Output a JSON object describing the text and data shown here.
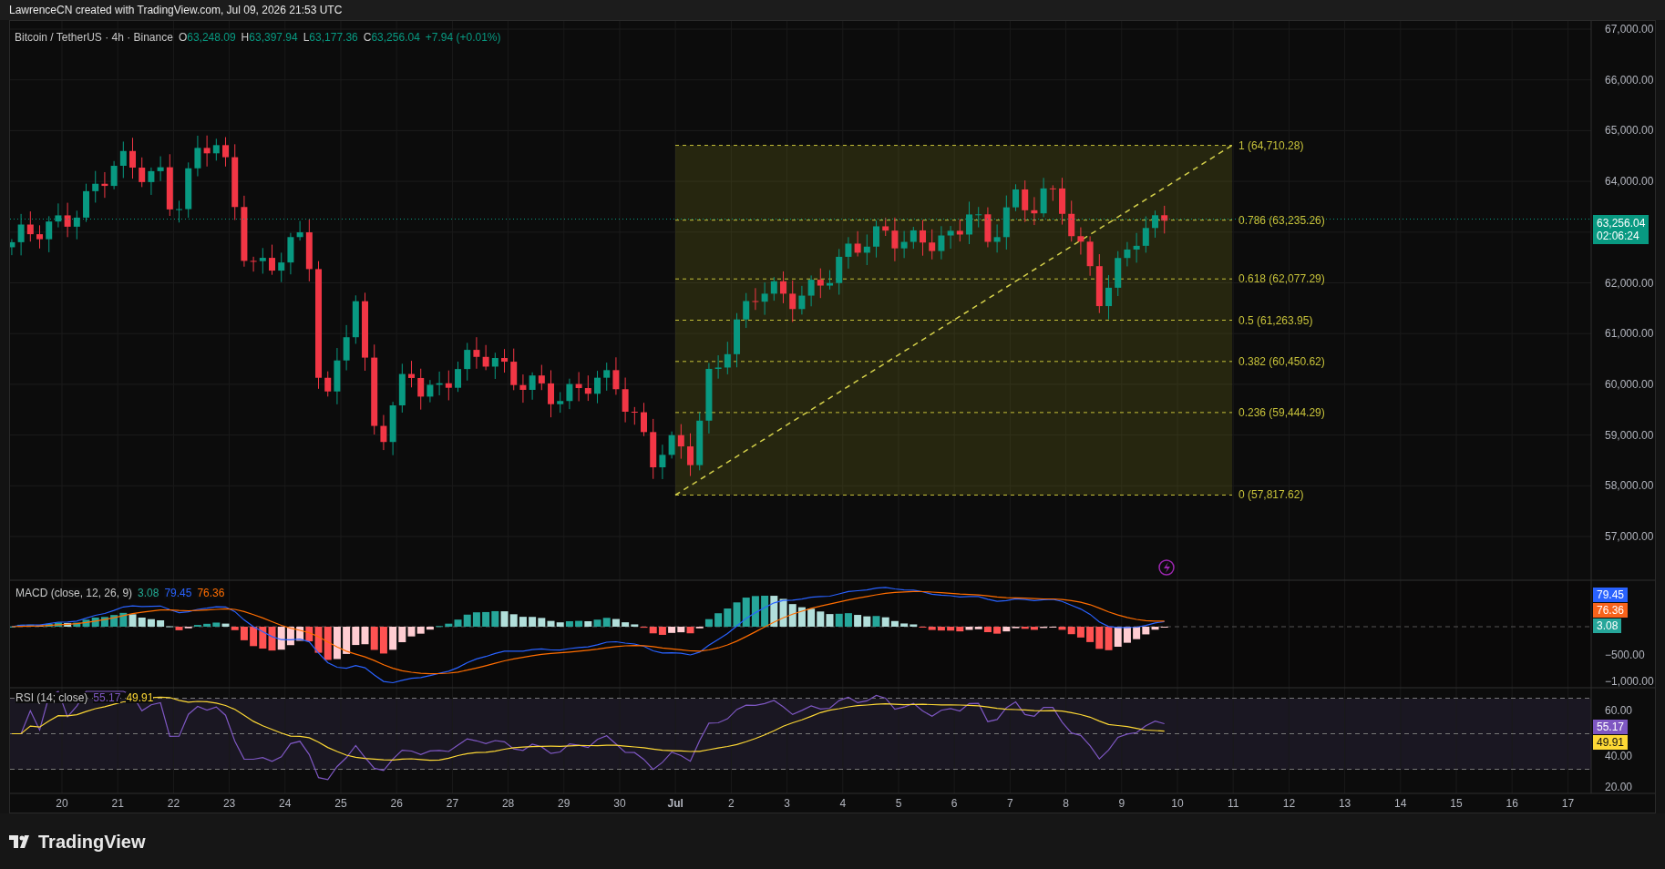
{
  "header": {
    "text": "LawrenceCN created with TradingView.com, Jul 09, 2026 21:53 UTC"
  },
  "legend": {
    "symbol": "Bitcoin / TetherUS · 4h · Binance",
    "ohlc": [
      {
        "label": "O",
        "value": "63,248.09"
      },
      {
        "label": "H",
        "value": "63,397.94"
      },
      {
        "label": "L",
        "value": "63,177.36"
      },
      {
        "label": "C",
        "value": "63,256.04"
      }
    ],
    "change": "+7.94 (+0.01%)"
  },
  "price_axis_upper": [
    "67,000.00",
    "66,000.00",
    "65,000.00",
    "64,000.00"
  ],
  "price_axis_lower": [
    "62,000.00",
    "61,000.00",
    "60,000.00",
    "59,000.00",
    "58,000.00",
    "57,000.00"
  ],
  "last_price": {
    "price": "63,256.04",
    "countdown": "02:06:24"
  },
  "fib_levels": [
    {
      "label": "1 (64,710.28)"
    },
    {
      "label": "0.786 (63,235.26)"
    },
    {
      "label": "0.618 (62,077.29)"
    },
    {
      "label": "0.5 (61,263.95)"
    },
    {
      "label": "0.382 (60,450.62)"
    },
    {
      "label": "0.236 (59,444.29)"
    },
    {
      "label": "0 (57,817.62)"
    }
  ],
  "macd": {
    "title": "MACD (close, 12, 26, 9)",
    "values": [
      {
        "text": "3.08",
        "color": "#22ab94"
      },
      {
        "text": "79.45",
        "color": "#2962ff"
      },
      {
        "text": "76.36",
        "color": "#ff6d00"
      }
    ],
    "axis": [
      "−500.00",
      "−1,000.00"
    ],
    "badges": [
      {
        "text": "79.45",
        "color": "#2962ff"
      },
      {
        "text": "76.36",
        "color": "#f7631b"
      },
      {
        "text": "3.08",
        "color": "#26a69a"
      }
    ]
  },
  "rsi": {
    "title": "RSI (14; close)",
    "values": [
      {
        "text": "55.17",
        "color": "#7e57c2"
      },
      {
        "text": "49.91",
        "color": "#fdd835"
      }
    ],
    "axis": [
      "60.00",
      "40.00",
      "20.00"
    ],
    "badges": [
      {
        "text": "55.17",
        "color": "#7e57c2"
      },
      {
        "text": "49.91",
        "color": "#fdd835"
      }
    ]
  },
  "time_axis": [
    {
      "text": "20",
      "bold": false
    },
    {
      "text": "21",
      "bold": false
    },
    {
      "text": "22",
      "bold": false
    },
    {
      "text": "23",
      "bold": false
    },
    {
      "text": "24",
      "bold": false
    },
    {
      "text": "25",
      "bold": false
    },
    {
      "text": "26",
      "bold": false
    },
    {
      "text": "27",
      "bold": false
    },
    {
      "text": "28",
      "bold": false
    },
    {
      "text": "29",
      "bold": false
    },
    {
      "text": "30",
      "bold": false
    },
    {
      "text": "Jul",
      "bold": true
    },
    {
      "text": "2",
      "bold": false
    },
    {
      "text": "3",
      "bold": false
    },
    {
      "text": "4",
      "bold": false
    },
    {
      "text": "5",
      "bold": false
    },
    {
      "text": "6",
      "bold": false
    },
    {
      "text": "7",
      "bold": false
    },
    {
      "text": "8",
      "bold": false
    },
    {
      "text": "9",
      "bold": false
    },
    {
      "text": "10",
      "bold": false
    },
    {
      "text": "11",
      "bold": false
    },
    {
      "text": "12",
      "bold": false
    },
    {
      "text": "13",
      "bold": false
    },
    {
      "text": "14",
      "bold": false
    },
    {
      "text": "15",
      "bold": false
    },
    {
      "text": "16",
      "bold": false
    },
    {
      "text": "17",
      "bold": false
    }
  ],
  "brand": {
    "name": "TradingView"
  }
}
